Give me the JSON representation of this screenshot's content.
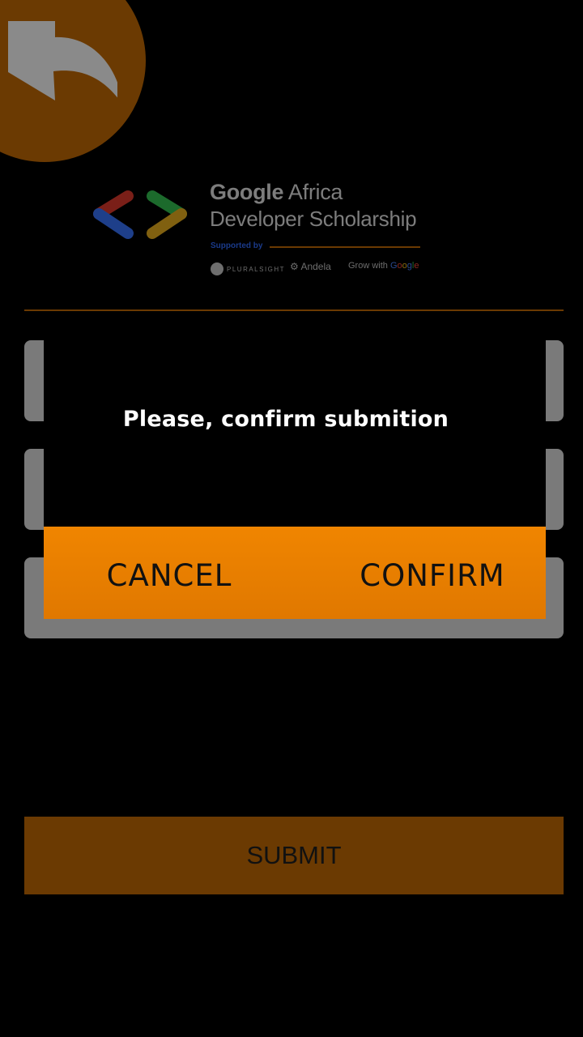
{
  "header": {
    "back_icon": "back-arrow-icon"
  },
  "logo": {
    "title_bold": "Google",
    "title_rest": " Africa",
    "subtitle": "Developer Scholarship",
    "supported_by": "Supported by",
    "sponsors": {
      "pluralsight": "PLURALSIGHT",
      "andela": "Andela",
      "grow_prefix": "Grow with ",
      "grow_google": [
        "G",
        "o",
        "o",
        "g",
        "l",
        "e"
      ]
    }
  },
  "form": {
    "submit_label": "SUBMIT"
  },
  "dialog": {
    "message": "Please, confirm submition",
    "cancel_label": "CANCEL",
    "confirm_label": "CONFIRM"
  },
  "colors": {
    "accent": "#f08500",
    "accent_dimmed": "#6b3a02",
    "field_dimmed": "#7a7a7a",
    "background": "#000000"
  }
}
